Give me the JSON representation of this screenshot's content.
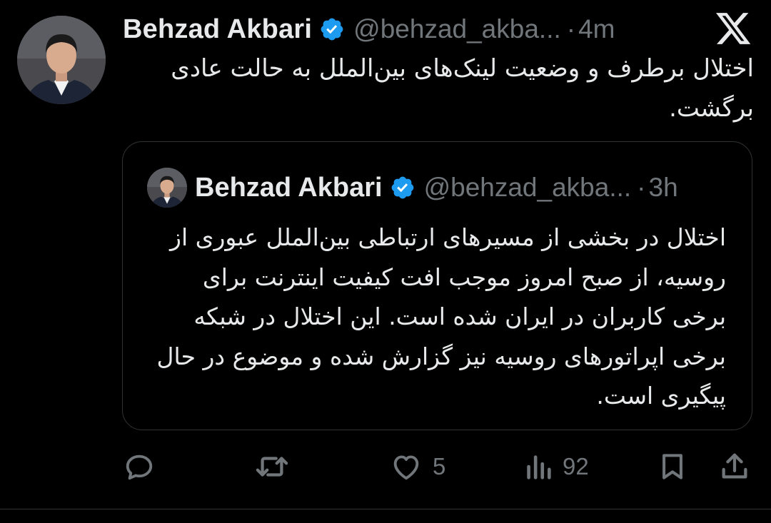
{
  "tweet": {
    "author_name": "Behzad Akbari",
    "handle": "@behzad_akba...",
    "dot": "·",
    "time": "4m",
    "text": "اختلال برطرف و وضعیت لینک‌های بین‌الملل به حالت عادی برگشت."
  },
  "quoted_tweet": {
    "author_name": "Behzad Akbari",
    "handle": "@behzad_akba...",
    "dot": "·",
    "time": "3h",
    "text": "اختلال در بخشی از مسیرهای ارتباطی بین‌الملل عبوری از روسیه، از صبح امروز موجب افت کیفیت اینترنت برای برخی کاربران در ایران شده است. این اختلال در شبکه برخی اپراتورهای روسیه نیز گزارش شده و موضوع در حال پیگیری است."
  },
  "actions": {
    "reply_icon": "reply-icon",
    "retweet_icon": "retweet-icon",
    "like_icon": "heart-icon",
    "like_count": "5",
    "views_icon": "views-icon",
    "views_count": "92",
    "bookmark_icon": "bookmark-icon",
    "share_icon": "share-icon"
  },
  "colors": {
    "background": "#000000",
    "text_primary": "#e7e9ea",
    "text_secondary": "#71767b",
    "verified": "#1d9bf0",
    "border": "#2f3336"
  },
  "platform_logo": "x-logo"
}
